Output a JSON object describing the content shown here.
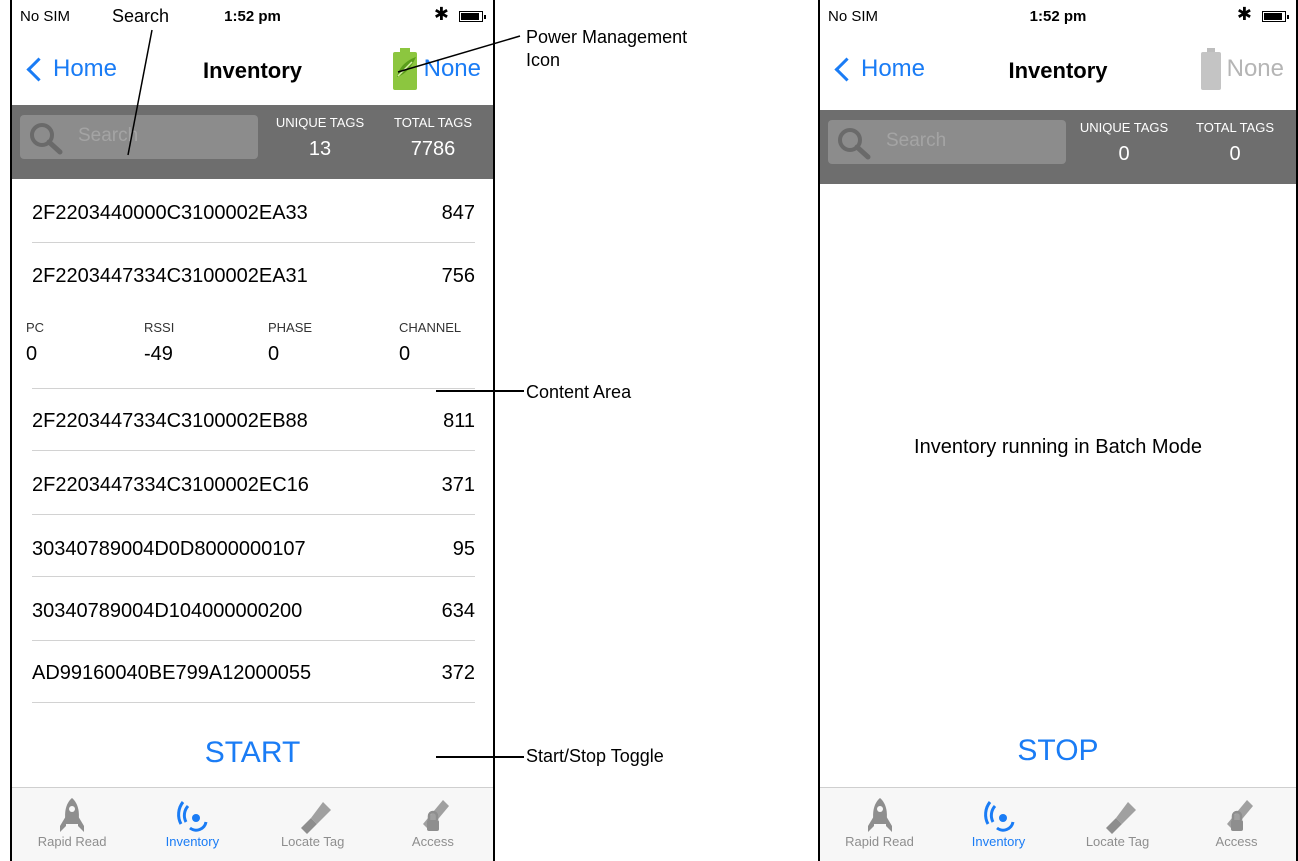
{
  "status": {
    "carrier": "No SIM",
    "time": "1:52 pm"
  },
  "nav": {
    "back_label": "Home",
    "title": "Inventory",
    "power_label": "None"
  },
  "search": {
    "placeholder": "Search"
  },
  "stats_labels": {
    "unique": "UNIQUE TAGS",
    "total": "TOTAL TAGS"
  },
  "left_screen": {
    "unique_tags": "13",
    "total_tags": "7786",
    "rows": [
      {
        "epc": "2F2203440000C3100002EA33",
        "count": "847"
      },
      {
        "epc": "2F2203447334C3100002EA31",
        "count": "756"
      },
      {
        "epc": "2F2203447334C3100002EB88",
        "count": "811"
      },
      {
        "epc": "2F2203447334C3100002EC16",
        "count": "371"
      },
      {
        "epc": "30340789004D0D8000000107",
        "count": "95"
      },
      {
        "epc": "30340789004D104000000200",
        "count": "634"
      },
      {
        "epc": "AD99160040BE799A12000055",
        "count": "372"
      }
    ],
    "detail": {
      "pc_label": "PC",
      "pc_value": "0",
      "rssi_label": "RSSI",
      "rssi_value": "-49",
      "phase_label": "PHASE",
      "phase_value": "0",
      "channel_label": "CHANNEL",
      "channel_value": "0"
    },
    "toggle_label": "START"
  },
  "right_screen": {
    "unique_tags": "0",
    "total_tags": "0",
    "message": "Inventory running in Batch Mode",
    "toggle_label": "STOP"
  },
  "tabs": [
    {
      "label": "Rapid Read",
      "icon": "rocket-icon",
      "active": false
    },
    {
      "label": "Inventory",
      "icon": "antenna-waves-icon",
      "active": true
    },
    {
      "label": "Locate Tag",
      "icon": "flashlight-icon",
      "active": false
    },
    {
      "label": "Access",
      "icon": "tag-lock-icon",
      "active": false
    }
  ],
  "callouts": {
    "search": "Search",
    "power": "Power Management\nIcon",
    "content": "Content Area",
    "toggle": "Start/Stop Toggle"
  },
  "colors": {
    "accent": "#1a7cf5",
    "header_bar": "#6e6e6e",
    "battery_green": "#8cc63f"
  }
}
